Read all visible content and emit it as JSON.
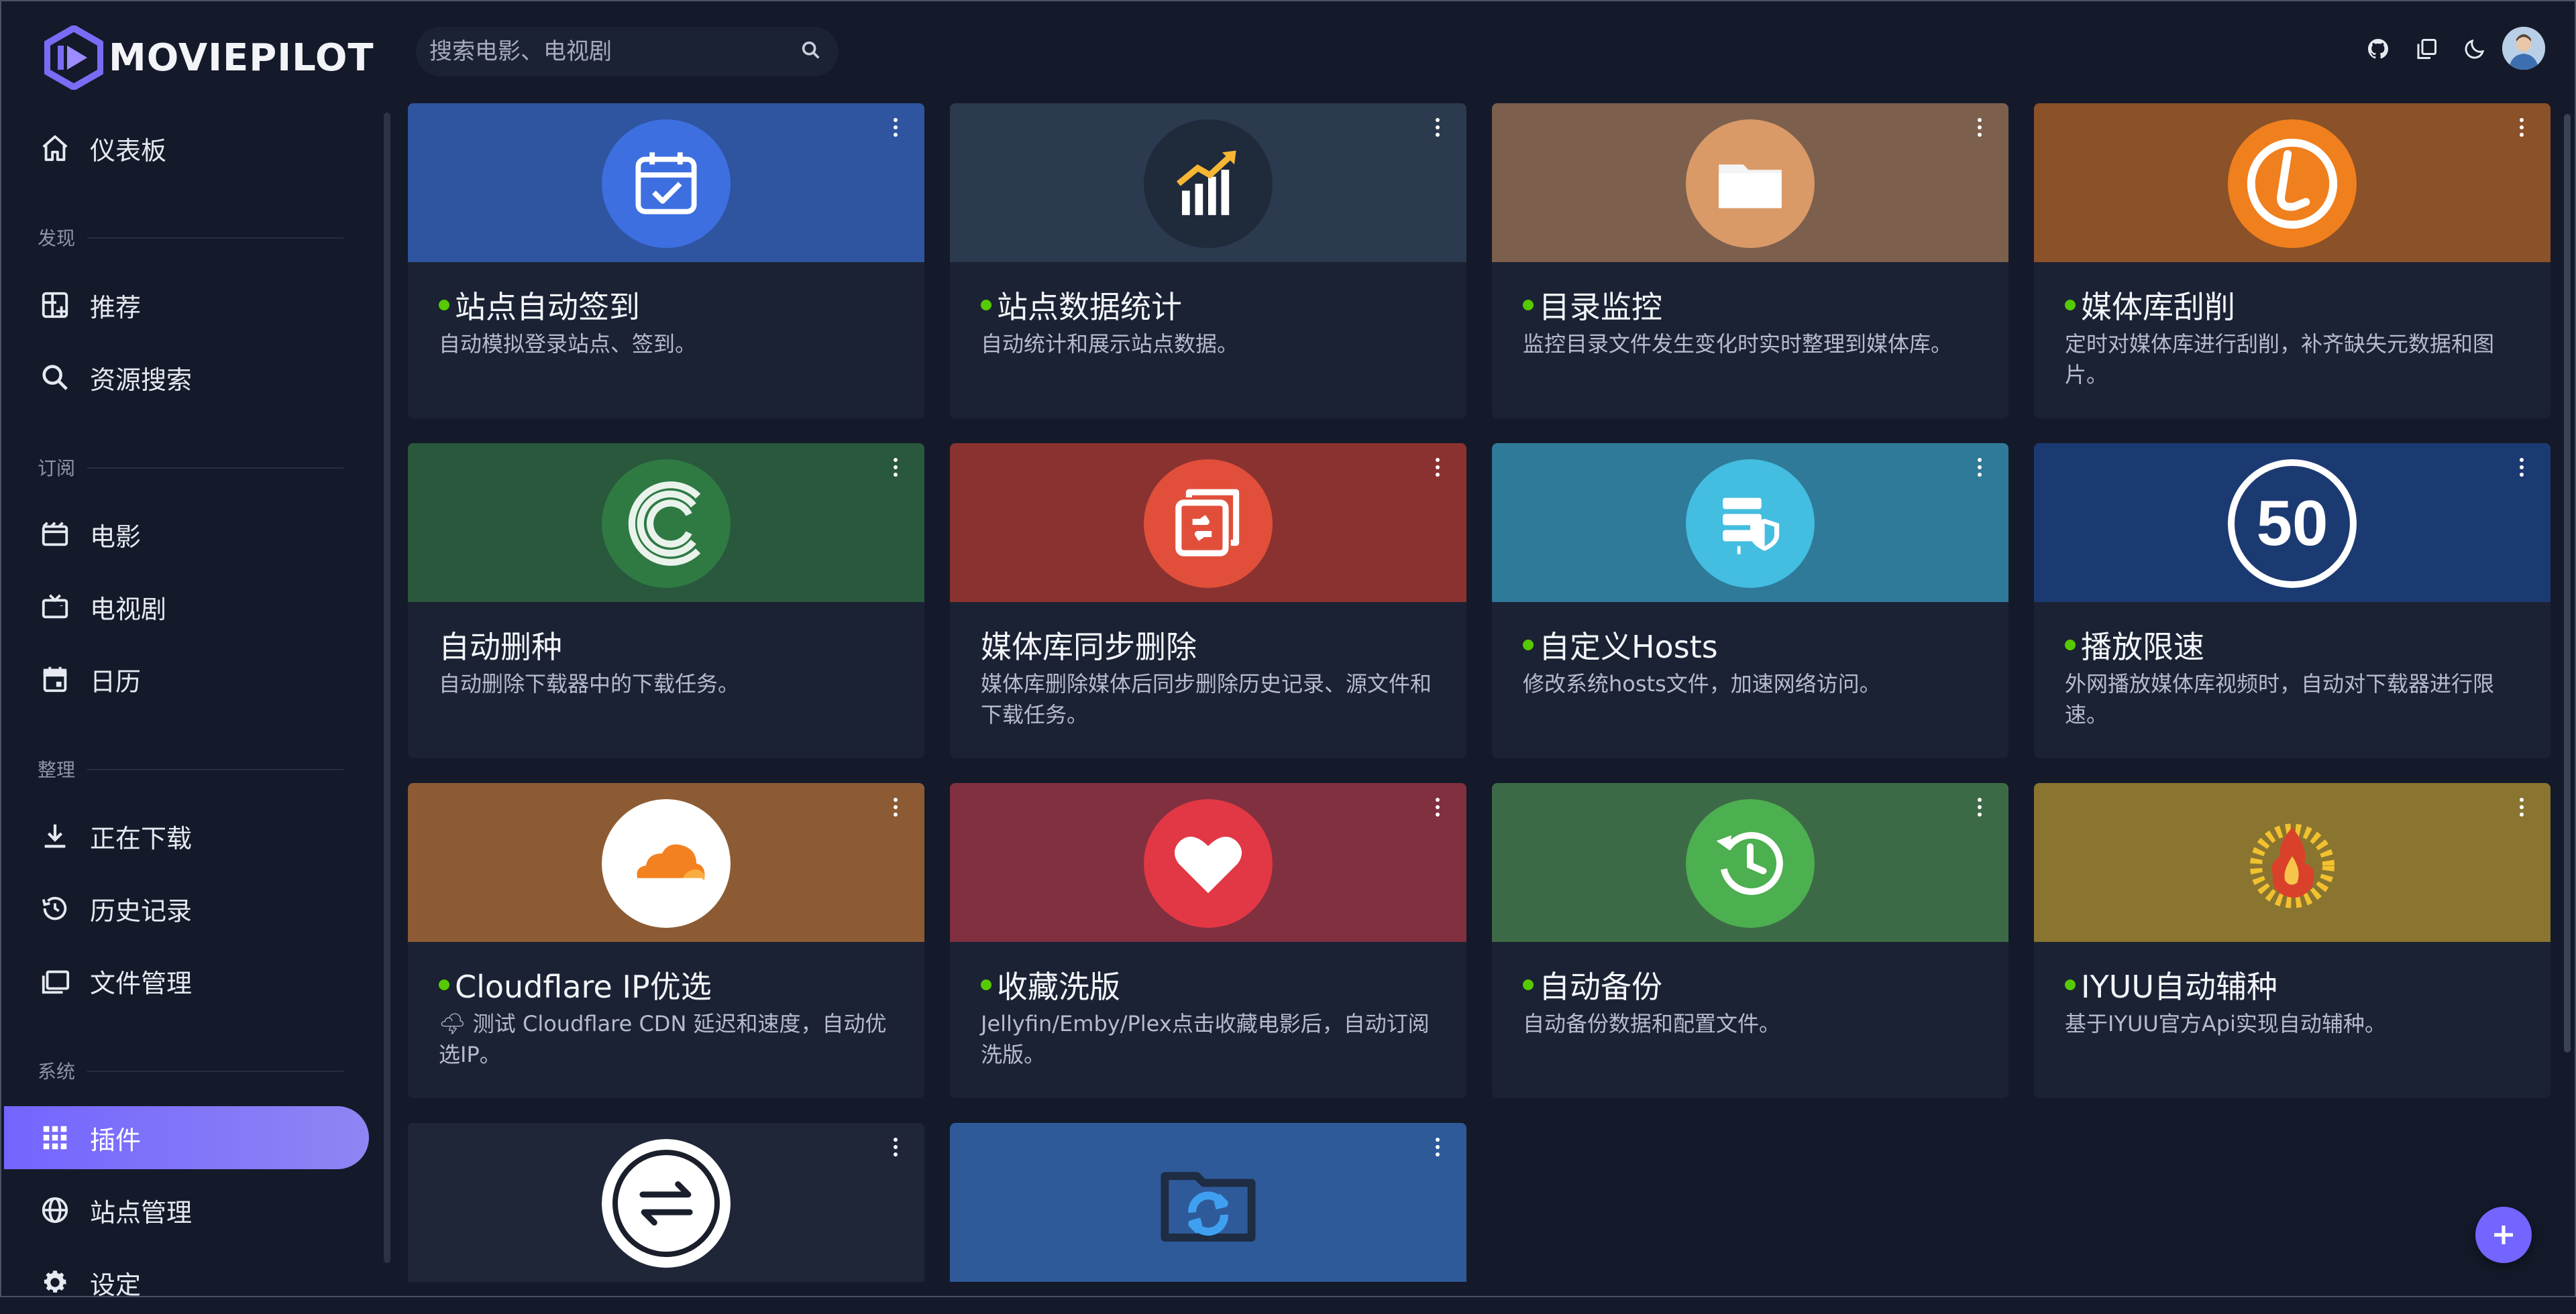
{
  "app": {
    "name": "MOVIEPILOT"
  },
  "search": {
    "placeholder": "搜索电影、电视剧"
  },
  "sidebar": {
    "top_item": "仪表板",
    "sections": {
      "discover": "发现",
      "subscribe": "订阅",
      "organize": "整理",
      "system": "系统"
    },
    "items": {
      "recommend": "推荐",
      "resource_search": "资源搜索",
      "movies": "电影",
      "tv": "电视剧",
      "calendar": "日历",
      "downloading": "正在下载",
      "history": "历史记录",
      "file_manager": "文件管理",
      "plugins": "插件",
      "sites": "站点管理",
      "settings": "设定"
    },
    "active": "plugins"
  },
  "header_icons": [
    "github-icon",
    "copy-icon",
    "moon-icon",
    "avatar"
  ],
  "plugins": [
    {
      "title": "站点自动签到",
      "desc": "自动模拟登录站点、签到。",
      "enabled": true,
      "banner": "#2f55a0",
      "icon": "calendar-check-icon"
    },
    {
      "title": "站点数据统计",
      "desc": "自动统计和展示站点数据。",
      "enabled": true,
      "banner": "#2b3a4e",
      "icon": "bar-chart-icon"
    },
    {
      "title": "目录监控",
      "desc": "监控目录文件发生变化时实时整理到媒体库。",
      "enabled": true,
      "banner": "#7d5f4d",
      "icon": "folder-icon"
    },
    {
      "title": "媒体库刮削",
      "desc": "定时对媒体库进行刮削，补齐缺失元数据和图片。",
      "enabled": true,
      "banner": "#8b5128",
      "icon": "tinymedia-icon"
    },
    {
      "title": "自动删种",
      "desc": "自动删除下载器中的下载任务。",
      "enabled": false,
      "banner": "#29583d",
      "icon": "qbittorrent-icon"
    },
    {
      "title": "媒体库同步删除",
      "desc": "媒体库删除媒体后同步删除历史记录、源文件和下载任务。",
      "enabled": false,
      "banner": "#8a3230",
      "icon": "sync-delete-icon"
    },
    {
      "title": "自定义Hosts",
      "desc": "修改系统hosts文件，加速网络访问。",
      "enabled": true,
      "banner": "#2f7a99",
      "icon": "server-shield-icon"
    },
    {
      "title": "播放限速",
      "desc": "外网播放媒体库视频时，自动对下载器进行限速。",
      "enabled": true,
      "banner": "#1c3a72",
      "icon": "speed-limit-icon",
      "icon_text": "50"
    },
    {
      "title": "Cloudflare IP优选",
      "desc": "🌩 测试 Cloudflare CDN 延迟和速度，自动优选IP。",
      "enabled": true,
      "banner": "#8d5b33",
      "icon": "cloudflare-icon"
    },
    {
      "title": "收藏洗版",
      "desc": "Jellyfin/Emby/Plex点击收藏电影后，自动订阅洗版。",
      "enabled": true,
      "banner": "#80303f",
      "icon": "heart-icon"
    },
    {
      "title": "自动备份",
      "desc": "自动备份数据和配置文件。",
      "enabled": true,
      "banner": "#3d6a46",
      "icon": "backup-clock-icon"
    },
    {
      "title": "IYUU自动辅种",
      "desc": "基于IYUU官方Api实现自动辅种。",
      "enabled": true,
      "banner": "#8a7530",
      "icon": "iyuu-flame-icon"
    },
    {
      "title": "",
      "desc": "",
      "enabled": false,
      "banner": "#1f2638",
      "icon": "transfer-arrows-icon"
    },
    {
      "title": "",
      "desc": "",
      "enabled": false,
      "banner": "#2f5a99",
      "icon": "folder-sync-icon"
    }
  ],
  "colors": {
    "accent": "#7365ff",
    "status_on": "#56ca00",
    "background": "#141a2a",
    "card": "#1b2233"
  }
}
